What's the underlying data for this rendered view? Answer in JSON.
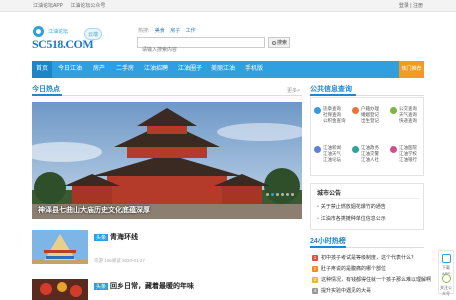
{
  "topbar": {
    "links": [
      "江油论坛APP",
      "江油论坛公众号"
    ],
    "login": "登录",
    "register": "注册",
    "sep": "|"
  },
  "logo": {
    "sub": "江油论坛",
    "text": "SC518.COM",
    "cloud": "云端"
  },
  "search": {
    "tags_label": "热搜:",
    "tags": [
      "美食",
      "房子",
      "工作"
    ],
    "placeholder": "请输入搜索内容",
    "button": "搜索"
  },
  "nav": {
    "items": [
      "首页",
      "今日江油",
      "房产",
      "二手房",
      "江油招聘",
      "江油圈子",
      "美丽江油",
      "手机版"
    ],
    "hot": "热门推荐"
  },
  "today": {
    "title": "今日热点",
    "more": "更多>"
  },
  "slide": {
    "caption": "神泽县七曲山大庙历史文化底蕴深厚",
    "dots": 6,
    "active": 1
  },
  "news": [
    {
      "tag": "头条",
      "title": "青海环线",
      "meta": "鸟游  106阅读   2020-01-27"
    },
    {
      "tag": "头条",
      "title": "回乡日常，藏着最暖的年味",
      "meta": ""
    }
  ],
  "query": {
    "title": "公共信息查询",
    "cells": [
      {
        "lines": [
          "违章查询",
          "社保查询",
          "公积金查询"
        ],
        "color": "#3a9ad9"
      },
      {
        "lines": [
          "户籍办理",
          "婚姻登记",
          "出生登记"
        ],
        "color": "#e9743b"
      },
      {
        "lines": [
          "公交查询",
          "天气查询",
          "快递查询"
        ],
        "color": "#7fb640"
      },
      {
        "lines": [
          "江油新闻",
          "江油天气",
          "江油论坛"
        ],
        "color": "#5b84d6"
      },
      {
        "lines": [
          "江油政务",
          "江油交警",
          "江油人社"
        ],
        "color": "#2ba59b"
      },
      {
        "lines": [
          "江油医院",
          "江油学校",
          "江油银行"
        ],
        "color": "#d44e8c"
      }
    ]
  },
  "notice": {
    "title": "城市公告",
    "items": [
      "关于禁止燃放烟花爆竹的通告",
      "江油市各类摊种单位信息公示"
    ]
  },
  "hot24": {
    "title": "24小时热榜",
    "items": [
      "初中孩子考试是等级制度，这个代表什么？",
      "肚子疼说的是腹痛的哪个部位",
      "这种情况，有钱都得住就一个孩子那么难以理解啊",
      "提升实验中遇见的大哥"
    ]
  },
  "float": {
    "app": "下载APP",
    "wx": "关注公众号"
  }
}
